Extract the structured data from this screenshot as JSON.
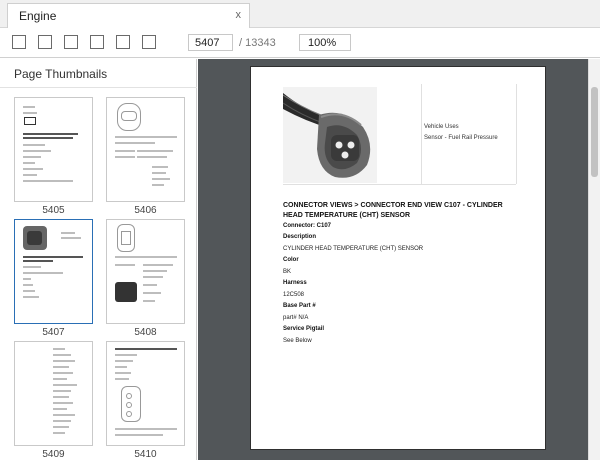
{
  "tab": {
    "title": "Engine",
    "close": "x"
  },
  "toolbar": {
    "page_value": "5407",
    "page_total": "/ 13343",
    "zoom": "100%"
  },
  "sidebar": {
    "title": "Page Thumbnails",
    "thumbnails": [
      {
        "label": "5405"
      },
      {
        "label": "5406"
      },
      {
        "label": "5407"
      },
      {
        "label": "5408"
      },
      {
        "label": "5409"
      },
      {
        "label": "5410"
      }
    ],
    "selected": "5407"
  },
  "document": {
    "vehicle_uses": "Vehicle Uses",
    "sensor": "Sensor - Fuel Rail Pressure",
    "heading": "CONNECTOR VIEWS > CONNECTOR END VIEW C107 - CYLINDER HEAD TEMPERATURE (CHT) SENSOR",
    "connector": "Connector: C107",
    "description_label": "Description",
    "description_value": "CYLINDER HEAD TEMPERATURE (CHT) SENSOR",
    "color_label": "Color",
    "color_value": "BK",
    "harness_label": "Harness",
    "harness_value": "12C508",
    "base_part_label": "Base Part #",
    "base_part_value": "part# N/A",
    "service_pigtail_label": "Service Pigtail",
    "service_pigtail_value": "See Below"
  }
}
